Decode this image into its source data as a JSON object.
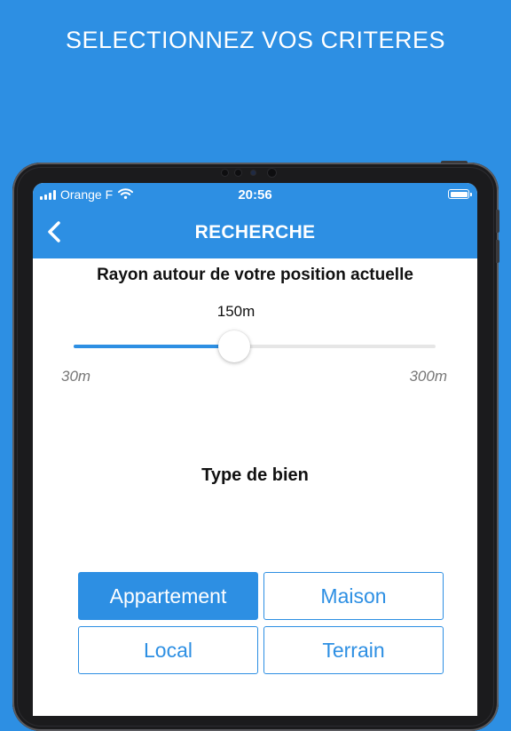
{
  "headline": "SELECTIONNEZ VOS CRITERES",
  "status_bar": {
    "carrier": "Orange F",
    "time": "20:56",
    "signal_icon": "signal-bars-icon",
    "wifi_icon": "wifi-icon",
    "battery_icon": "battery-icon"
  },
  "nav": {
    "title": "RECHERCHE",
    "back_icon": "chevron-left-icon"
  },
  "radius": {
    "label": "Rayon autour de votre position actuelle",
    "value_text": "150m",
    "min_label": "30m",
    "max_label": "300m",
    "min": 30,
    "max": 300,
    "value": 150
  },
  "property_type": {
    "label": "Type de bien",
    "options": [
      {
        "label": "Appartement",
        "selected": true
      },
      {
        "label": "Maison",
        "selected": false
      },
      {
        "label": "Local",
        "selected": false
      },
      {
        "label": "Terrain",
        "selected": false
      }
    ]
  },
  "colors": {
    "accent": "#2d8fe3",
    "background": "#2d8fe3",
    "device_frame": "#1b1b1d"
  }
}
